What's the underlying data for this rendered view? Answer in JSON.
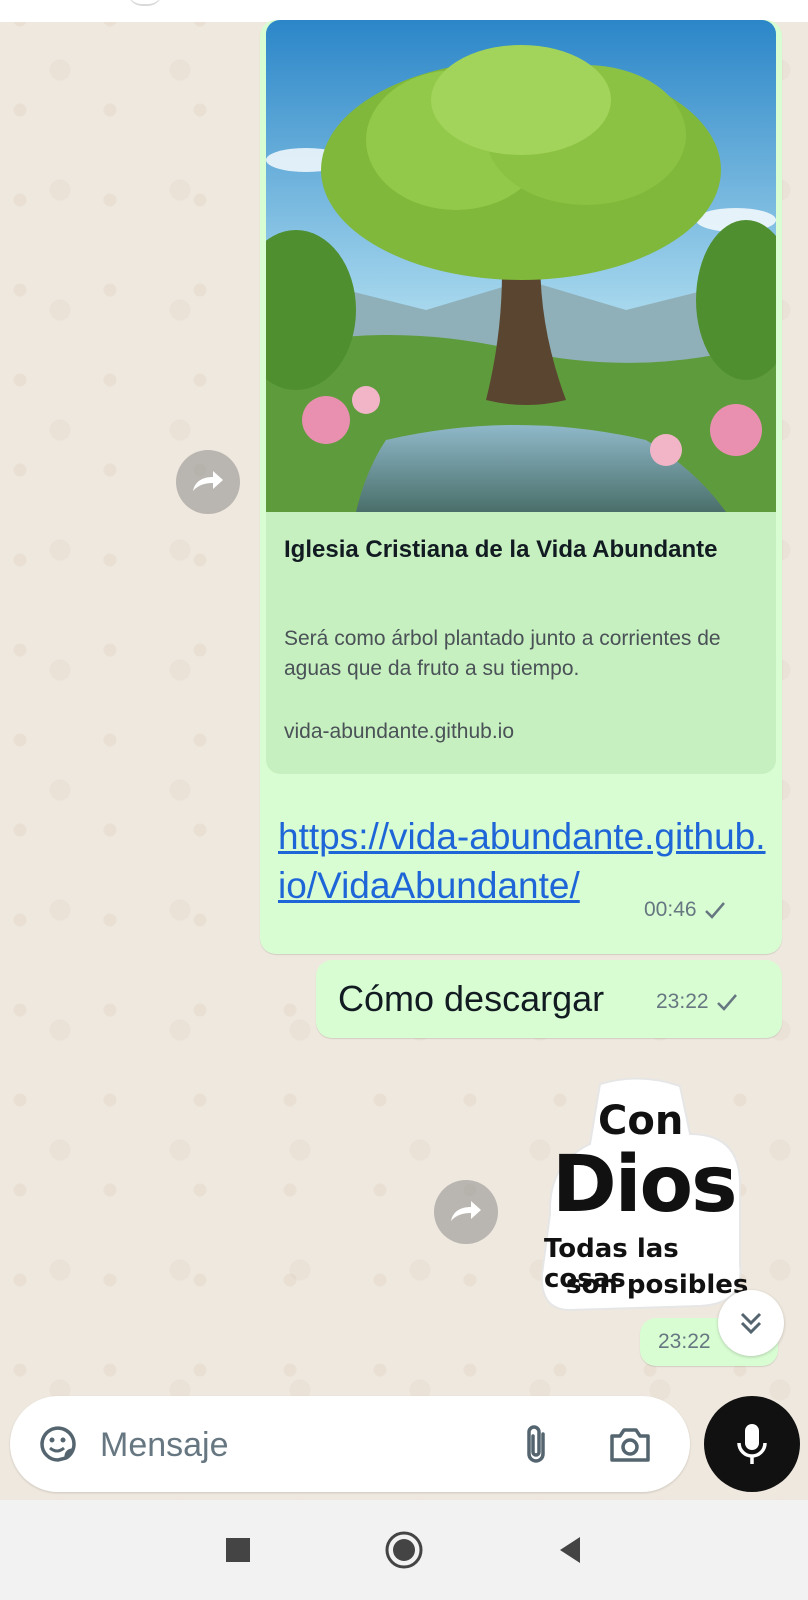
{
  "link_message": {
    "preview_title": "Iglesia Cristiana de la Vida Abundante",
    "preview_description": "Será como árbol plantado junto a corrientes de aguas que da fruto a su tiempo.",
    "preview_domain": "vida-abundante.github.io",
    "link_text": "https://vida-abundante.github.io/VidaAbundante/",
    "time": "00:46"
  },
  "text_message": {
    "text": "Cómo descargar",
    "time": "23:22"
  },
  "sticker_message": {
    "sticker_lines": [
      "Con",
      "Dios",
      "Todas las cosas",
      "son posibles"
    ],
    "time": "23:22"
  },
  "composer": {
    "placeholder": "Mensaje"
  },
  "icons": {
    "forward": "forward-icon",
    "sent": "single-check-icon",
    "emoji": "sticker-icon",
    "attach": "paperclip-icon",
    "camera": "camera-icon",
    "mic": "microphone-icon",
    "scroll": "chevrons-down-icon"
  },
  "colors": {
    "outgoing_bubble": "#d9fdd3",
    "link": "#1e66d8",
    "mic_button": "#111111"
  }
}
